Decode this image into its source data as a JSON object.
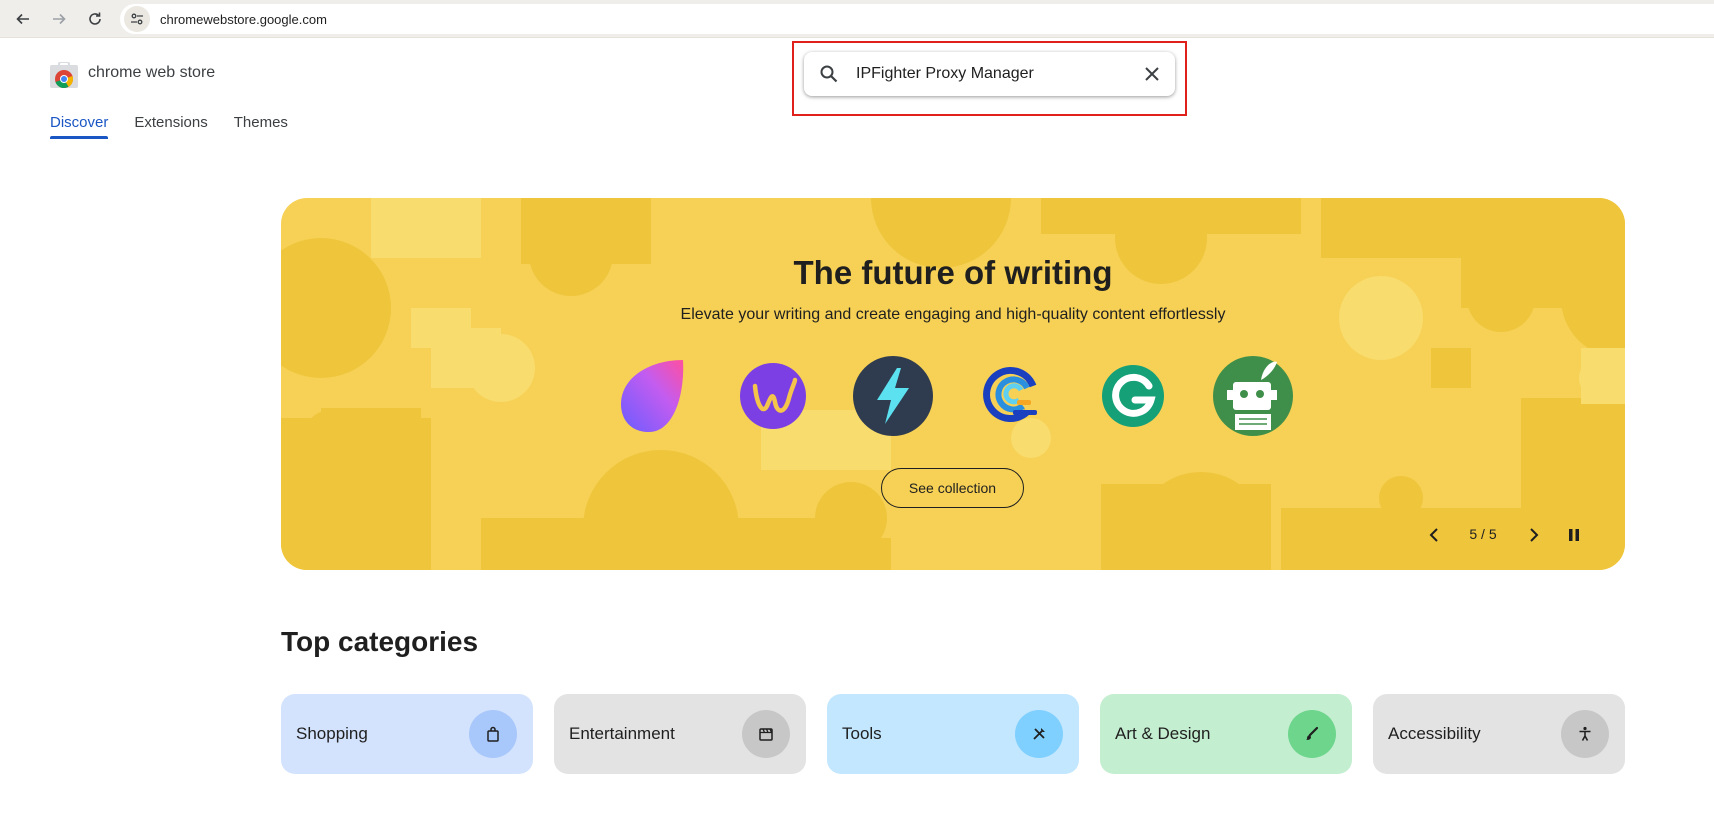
{
  "browser": {
    "url": "chromewebstore.google.com"
  },
  "header": {
    "brand": "chrome web store",
    "tabs": [
      {
        "label": "Discover",
        "active": true
      },
      {
        "label": "Extensions",
        "active": false
      },
      {
        "label": "Themes",
        "active": false
      }
    ]
  },
  "search": {
    "value": "IPFighter Proxy Manager",
    "highlight_color": "#e0201a"
  },
  "banner": {
    "title": "The future of writing",
    "subtitle": "Elevate your writing and create engaging and high-quality content effortlessly",
    "button_label": "See collection",
    "pager": "5 / 5",
    "background_color": "#f6d155",
    "icons": [
      "droplet-gradient-icon",
      "w-letter-icon",
      "lightning-icon",
      "wave-swirl-icon",
      "grammarly-g-icon",
      "robot-quill-icon"
    ]
  },
  "categories": {
    "title": "Top categories",
    "items": [
      {
        "label": "Shopping",
        "icon": "shopping-bag-icon",
        "bg": "#d3e3fd",
        "icon_bg": "#a8c7fa"
      },
      {
        "label": "Entertainment",
        "icon": "clapperboard-icon",
        "bg": "#e3e3e3",
        "icon_bg": "#c7c7c7"
      },
      {
        "label": "Tools",
        "icon": "tools-icon",
        "bg": "#c2e7ff",
        "icon_bg": "#7fcfff"
      },
      {
        "label": "Art & Design",
        "icon": "brush-icon",
        "bg": "#c4eed0",
        "icon_bg": "#6dd58c"
      },
      {
        "label": "Accessibility",
        "icon": "accessibility-icon",
        "bg": "#e3e3e3",
        "icon_bg": "#c7c7c7"
      }
    ]
  }
}
